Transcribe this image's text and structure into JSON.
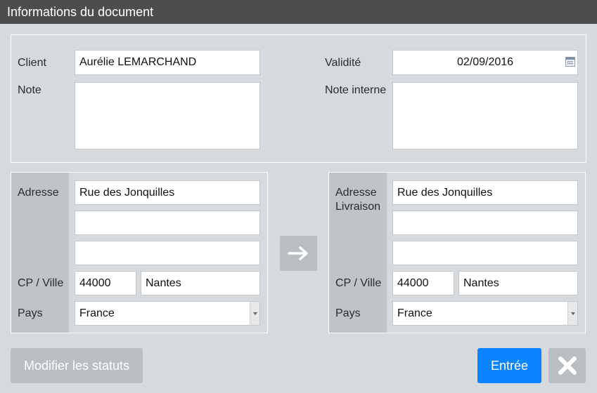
{
  "window": {
    "title": "Informations du document"
  },
  "document": {
    "client_label": "Client",
    "client_value": "Aurélie LEMARCHAND",
    "note_label": "Note",
    "note_value": "",
    "validite_label": "Validité",
    "validite_value": "02/09/2016",
    "note_interne_label": "Note interne",
    "note_interne_value": ""
  },
  "billing": {
    "adresse_label": "Adresse",
    "line1": "Rue des Jonquilles",
    "line2": "",
    "line3": "",
    "cp_ville_label": "CP / Ville",
    "cp": "44000",
    "ville": "Nantes",
    "pays_label": "Pays",
    "pays": "France"
  },
  "shipping": {
    "adresse_label_1": "Adresse",
    "adresse_label_2": "Livraison",
    "line1": "Rue des Jonquilles",
    "line2": "",
    "line3": "",
    "cp_ville_label": "CP / Ville",
    "cp": "44000",
    "ville": "Nantes",
    "pays_label": "Pays",
    "pays": "France"
  },
  "actions": {
    "modifier_statuts_label": "Modifier les statuts",
    "entree_label": "Entrée"
  },
  "icons": {
    "copy_address": "arrow-right-icon",
    "date_picker": "calendar-icon",
    "close": "close-icon",
    "select": "chevron-down-icon"
  },
  "colors": {
    "titlebar": "#4d4d4d",
    "primary": "#0a84ff",
    "disabled": "#b9bec3",
    "background": "#d6dadd"
  }
}
